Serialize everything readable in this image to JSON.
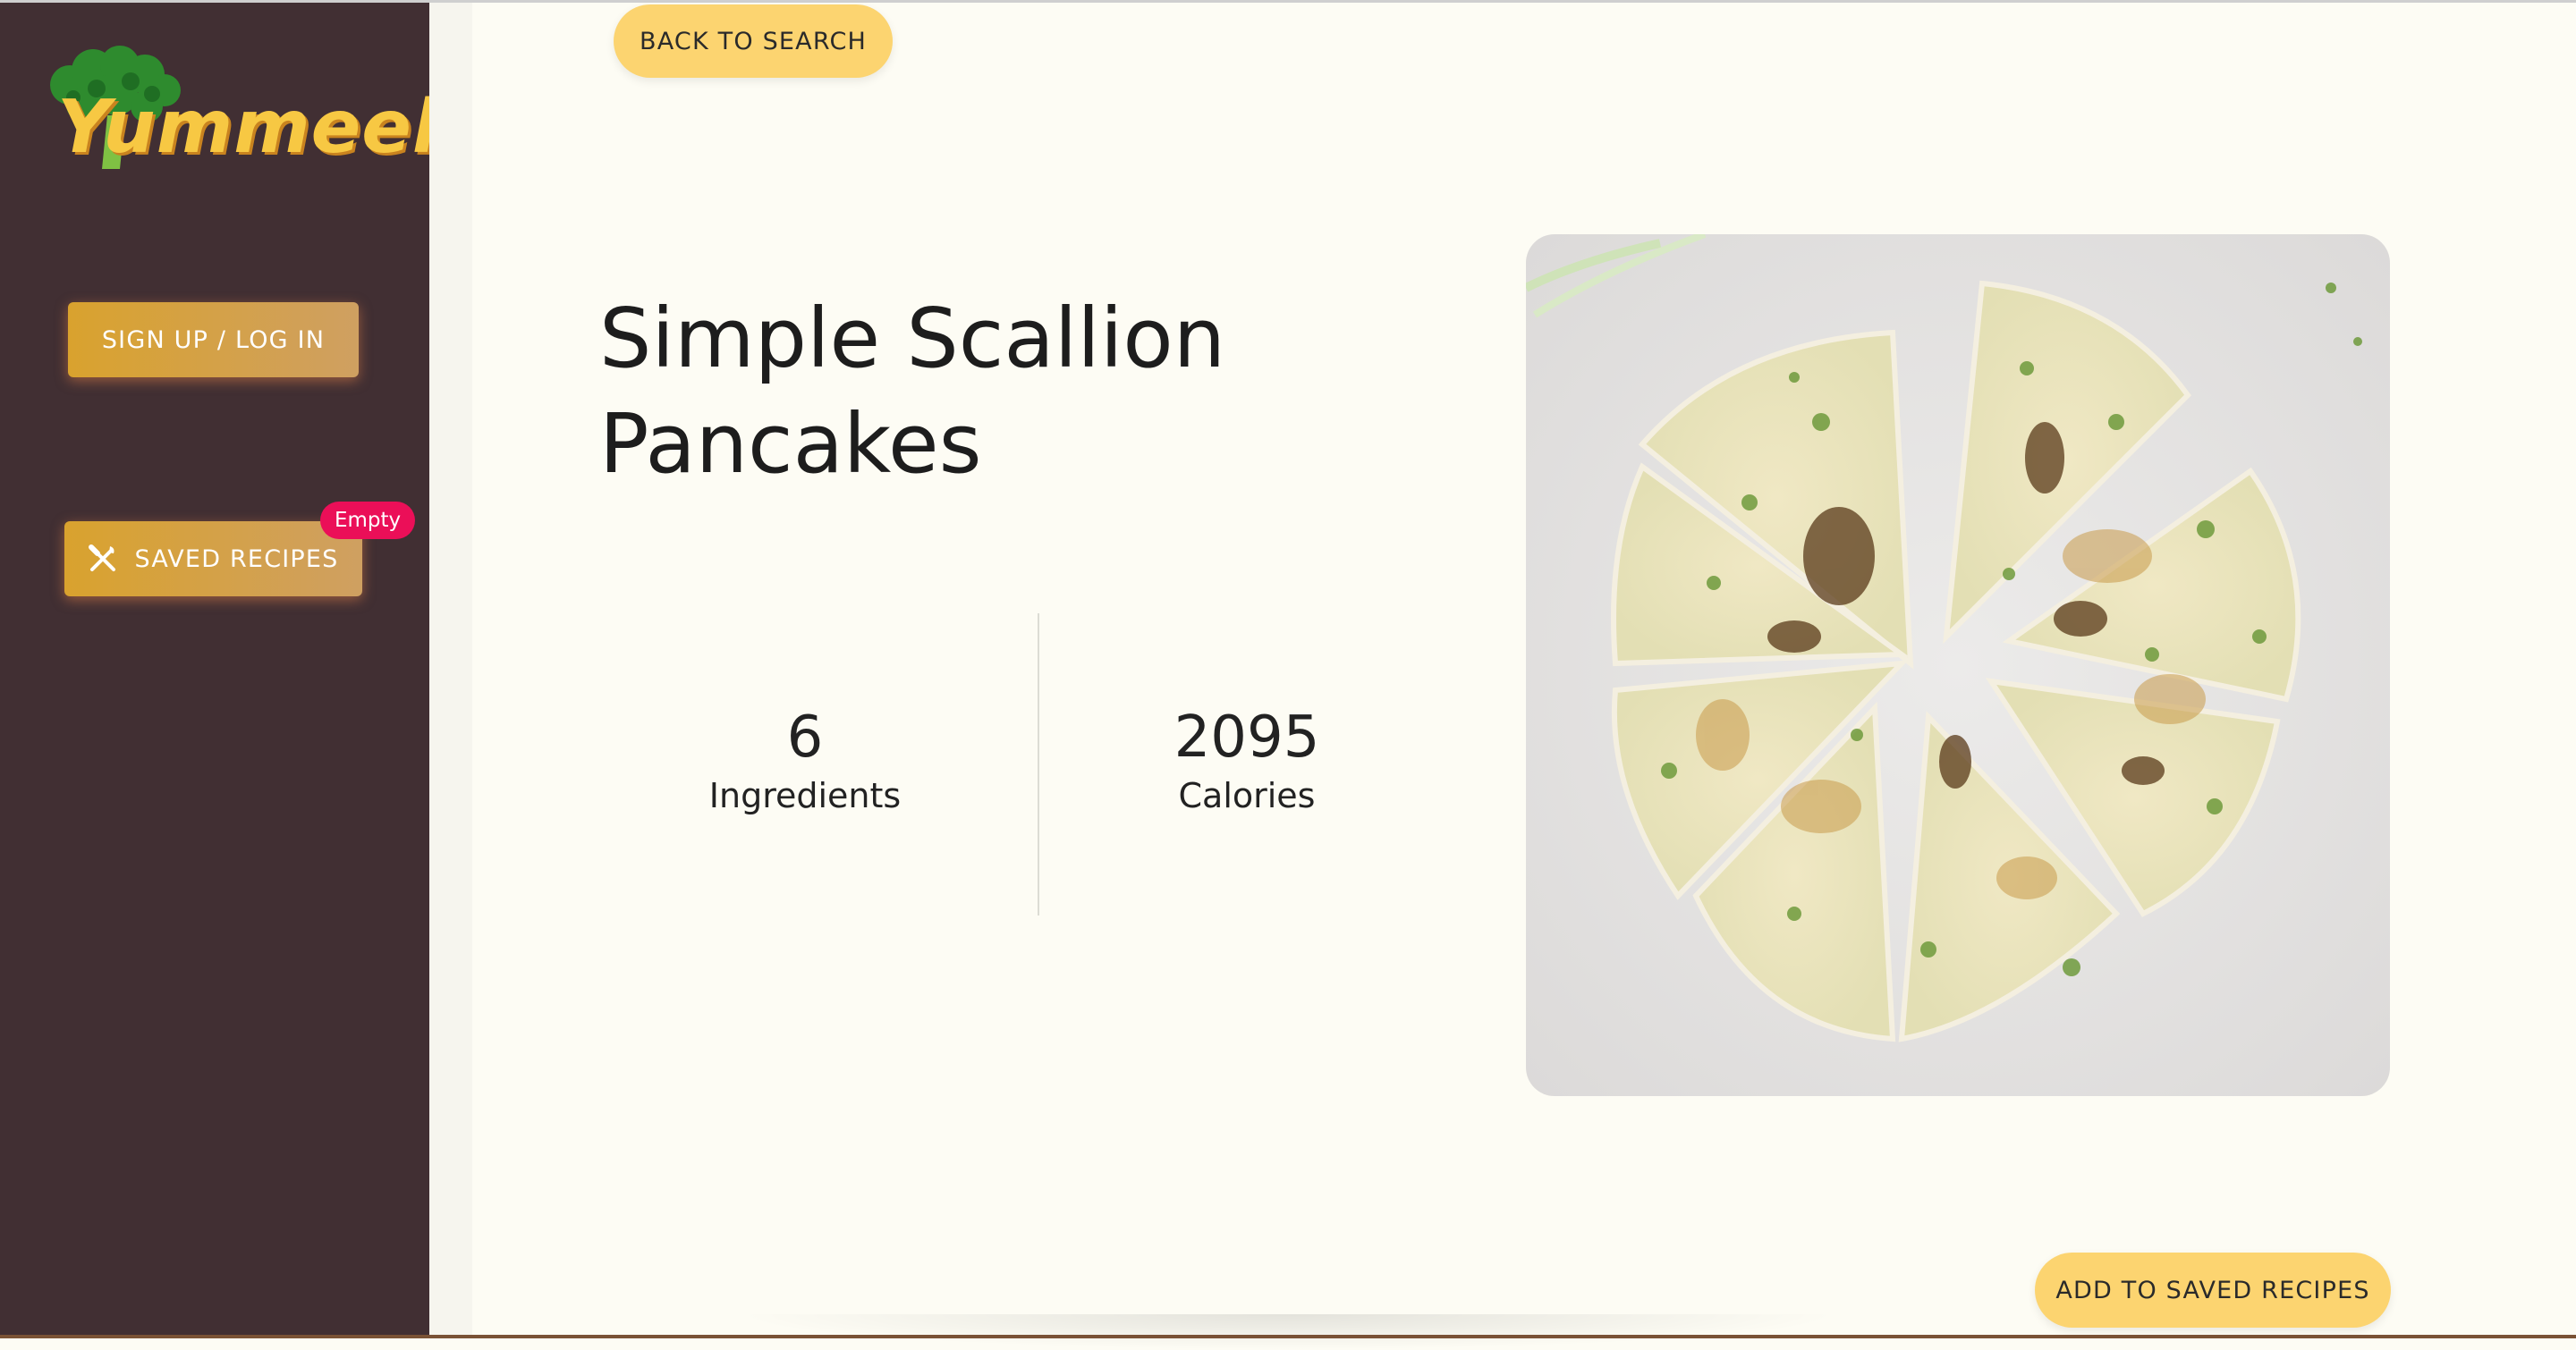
{
  "brand": {
    "name": "Yummeek"
  },
  "sidebar": {
    "signup_label": "SIGN UP / LOG IN",
    "saved_label": "SAVED RECIPES",
    "saved_badge": "Empty"
  },
  "main": {
    "back_label": "BACK TO SEARCH",
    "recipe_title": "Simple Scallion Pancakes",
    "stats": [
      {
        "value": "6",
        "label": "Ingredients"
      },
      {
        "value": "2095",
        "label": "Calories"
      }
    ],
    "add_label": "ADD TO SAVED RECIPES"
  },
  "colors": {
    "sidebar_bg": "#412f33",
    "page_bg": "#fdfcf4",
    "accent": "#fcd470",
    "badge": "#eb0f58"
  },
  "icons": {
    "logo": "broccoli-icon",
    "saved": "fork-knife-icon"
  }
}
